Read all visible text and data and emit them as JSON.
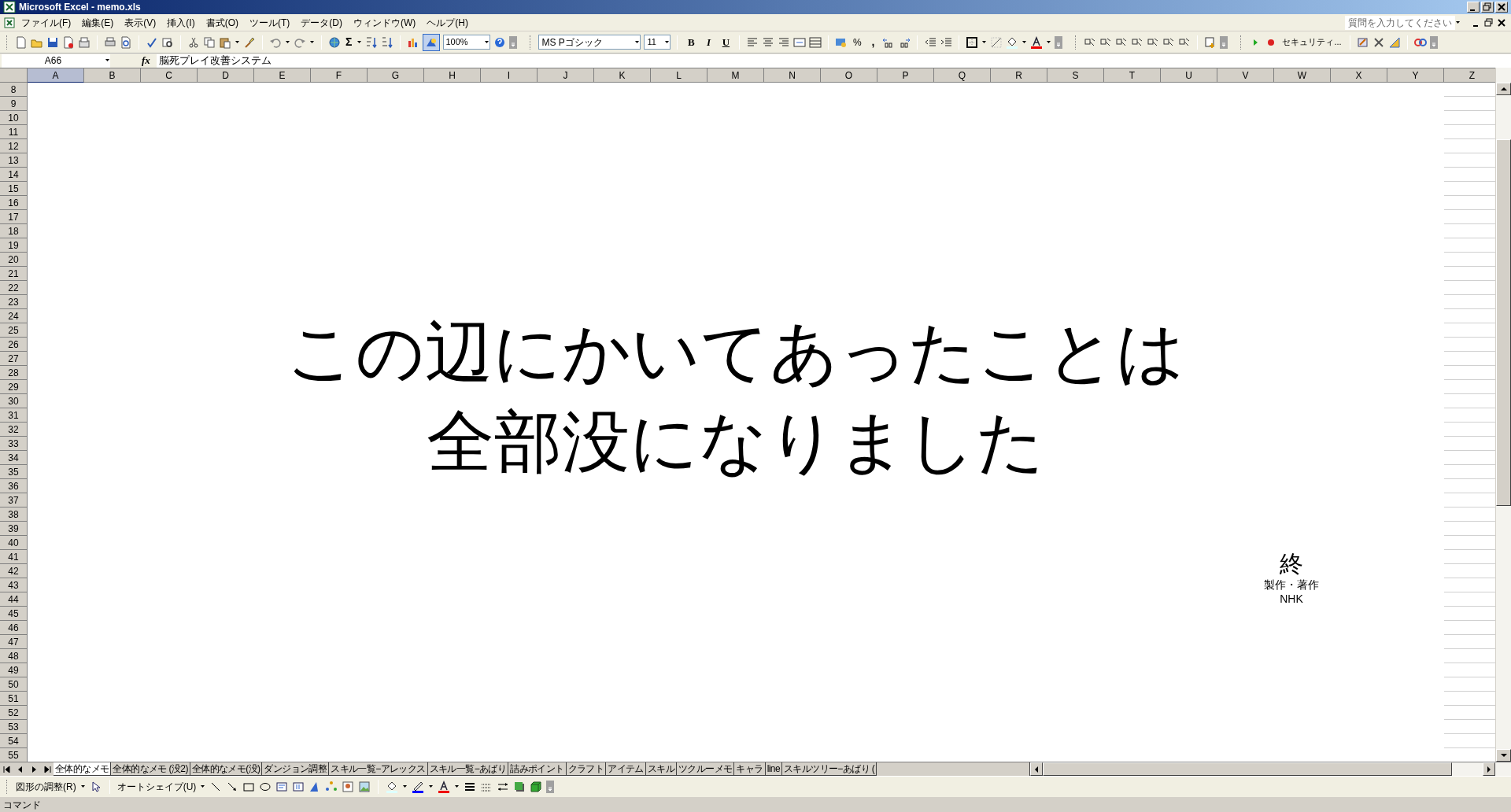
{
  "window": {
    "title": "Microsoft Excel - memo.xls"
  },
  "menu": [
    "ファイル(F)",
    "編集(E)",
    "表示(V)",
    "挿入(I)",
    "書式(O)",
    "ツール(T)",
    "データ(D)",
    "ウィンドウ(W)",
    "ヘルプ(H)"
  ],
  "help_box": {
    "placeholder": "質問を入力してください"
  },
  "standard_toolbar": {
    "sum": "Σ",
    "zoom": "100%"
  },
  "formatting_toolbar": {
    "font": "MS Pゴシック",
    "size": "11",
    "bold": "B",
    "italic": "I",
    "underline": "U",
    "percent": "%",
    "comma": ","
  },
  "security_toolbar": {
    "security": "セキュリティ..."
  },
  "formula_bar": {
    "name_box": "A66",
    "fx": "fx",
    "formula": "脳死プレイ改善システム"
  },
  "columns": [
    {
      "label": "A",
      "selected": true
    },
    {
      "label": "B",
      "selected": false
    },
    {
      "label": "C",
      "selected": false
    },
    {
      "label": "D",
      "selected": false
    },
    {
      "label": "E",
      "selected": false
    },
    {
      "label": "F",
      "selected": false
    },
    {
      "label": "G",
      "selected": false
    },
    {
      "label": "H",
      "selected": false
    },
    {
      "label": "I",
      "selected": false
    },
    {
      "label": "J",
      "selected": false
    },
    {
      "label": "K",
      "selected": false
    },
    {
      "label": "L",
      "selected": false
    },
    {
      "label": "M",
      "selected": false
    },
    {
      "label": "N",
      "selected": false
    },
    {
      "label": "O",
      "selected": false
    },
    {
      "label": "P",
      "selected": false
    },
    {
      "label": "Q",
      "selected": false
    },
    {
      "label": "R",
      "selected": false
    },
    {
      "label": "S",
      "selected": false
    },
    {
      "label": "T",
      "selected": false
    },
    {
      "label": "U",
      "selected": false
    },
    {
      "label": "V",
      "selected": false
    },
    {
      "label": "W",
      "selected": false
    },
    {
      "label": "X",
      "selected": false
    },
    {
      "label": "Y",
      "selected": false
    },
    {
      "label": "Z",
      "selected": false
    }
  ],
  "rows": [
    "8",
    "9",
    "10",
    "11",
    "12",
    "13",
    "14",
    "15",
    "16",
    "17",
    "18",
    "19",
    "20",
    "21",
    "22",
    "23",
    "24",
    "25",
    "26",
    "27",
    "28",
    "29",
    "30",
    "31",
    "32",
    "33",
    "34",
    "35",
    "36",
    "37",
    "38",
    "39",
    "40",
    "41",
    "42",
    "43",
    "44",
    "45",
    "46",
    "47",
    "48",
    "49",
    "50",
    "51",
    "52",
    "53",
    "54",
    "55"
  ],
  "textbox": {
    "lines": [
      "この辺にかいてあったことは",
      "全部没になりました"
    ],
    "end_mark": "終",
    "credit": "製作・著作",
    "producer": "NHK"
  },
  "sheet_tabs": [
    {
      "label": "全体的なメモ",
      "selected": true
    },
    {
      "label": "全体的なメモ (没2)",
      "selected": false
    },
    {
      "label": "全体的なメモ(没)",
      "selected": false
    },
    {
      "label": "ダンジョン調整",
      "selected": false
    },
    {
      "label": "スキル一覧−アレックス",
      "selected": false
    },
    {
      "label": "スキル一覧−あばり",
      "selected": false
    },
    {
      "label": "詰みポイント",
      "selected": false
    },
    {
      "label": "クラフト",
      "selected": false
    },
    {
      "label": "アイテム",
      "selected": false
    },
    {
      "label": "スキル",
      "selected": false
    },
    {
      "label": "ツクルーメモ",
      "selected": false
    },
    {
      "label": "キャラ",
      "selected": false
    },
    {
      "label": "line",
      "selected": false
    },
    {
      "label": "スキルツリー−あばり (",
      "selected": false
    }
  ],
  "drawing_toolbar": {
    "draw_menu": "図形の調整(R)",
    "autoshapes": "オートシェイプ(U)"
  },
  "status_bar": {
    "text": "コマンド"
  }
}
